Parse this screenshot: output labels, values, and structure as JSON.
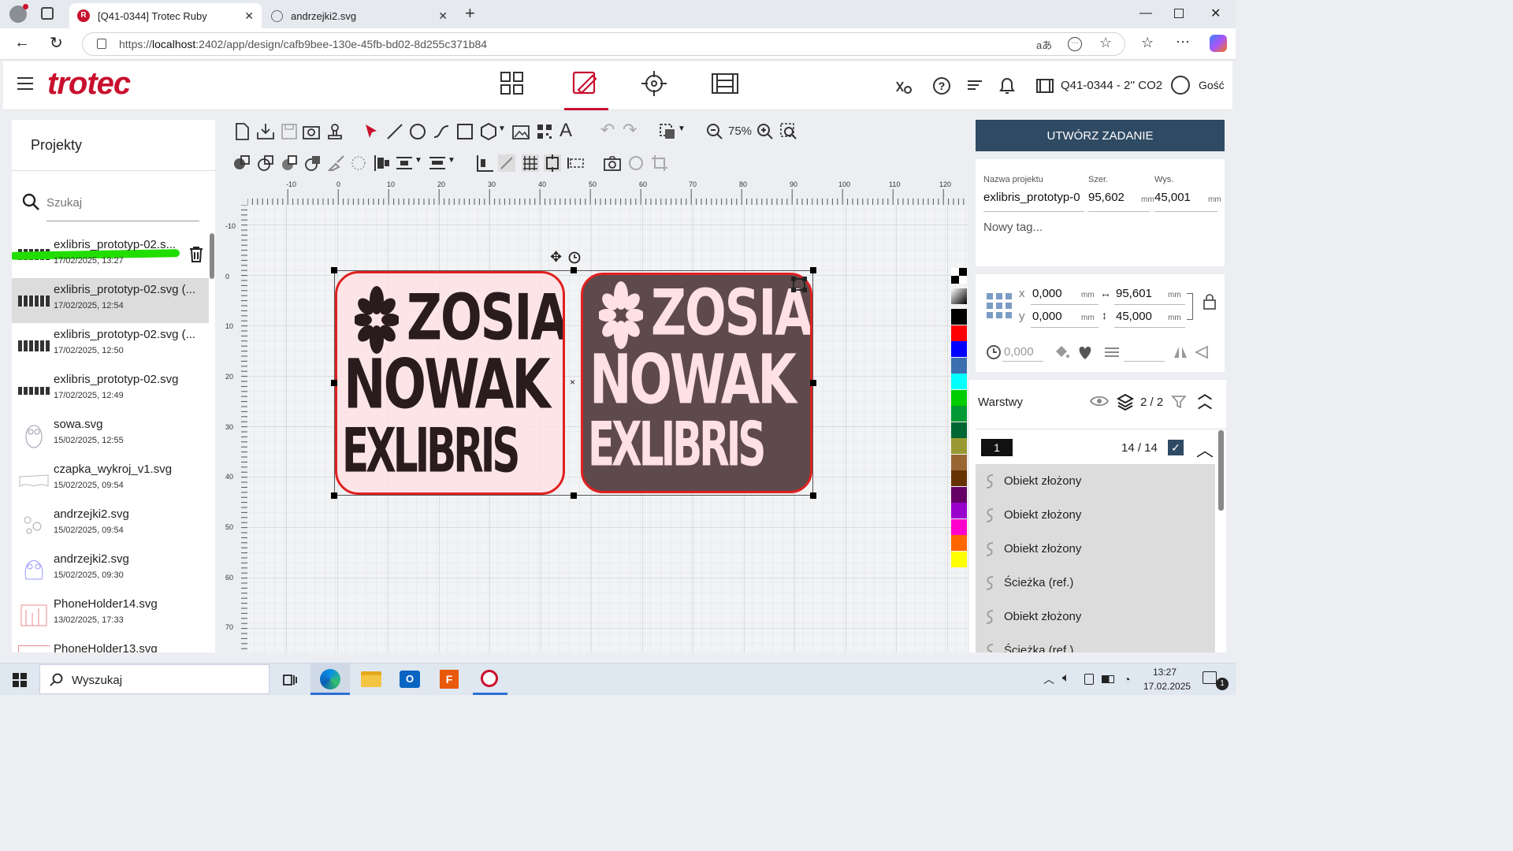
{
  "browser": {
    "tabs": [
      {
        "label": "[Q41-0344] Trotec Ruby",
        "active": true
      },
      {
        "label": "andrzejki2.svg",
        "active": false
      }
    ],
    "url_prefix": "https://",
    "url_host": "localhost",
    "url_rest": ":2402/app/design/cafb9bee-130e-45fb-bd02-8d255c371b84"
  },
  "app": {
    "logo": "trotec",
    "machine": "Q41-0344 - 2'' CO2",
    "user": "Gość"
  },
  "projects": {
    "title": "Projekty",
    "search_placeholder": "Szukaj",
    "items": [
      {
        "name": "exlibris_prototyp-02.s...",
        "date": "17/02/2025, 13:27"
      },
      {
        "name": "exlibris_prototyp-02.svg (...",
        "date": "17/02/2025, 12:54"
      },
      {
        "name": "exlibris_prototyp-02.svg (...",
        "date": "17/02/2025, 12:50"
      },
      {
        "name": "exlibris_prototyp-02.svg",
        "date": "17/02/2025, 12:49"
      },
      {
        "name": "sowa.svg",
        "date": "15/02/2025, 12:55"
      },
      {
        "name": "czapka_wykroj_v1.svg",
        "date": "15/02/2025, 09:54"
      },
      {
        "name": "andrzejki2.svg",
        "date": "15/02/2025, 09:54"
      },
      {
        "name": "andrzejki2.svg",
        "date": "15/02/2025, 09:30"
      },
      {
        "name": "PhoneHolder14.svg",
        "date": "13/02/2025, 17:33"
      },
      {
        "name": "PhoneHolder13.svg",
        "date": ""
      }
    ]
  },
  "toolbar": {
    "zoom": "75%"
  },
  "rulers": {
    "top": [
      "-10",
      "0",
      "10",
      "20",
      "30",
      "40",
      "50",
      "60",
      "70",
      "80",
      "90",
      "100",
      "110",
      "120"
    ],
    "left": [
      "-10",
      "0",
      "10",
      "20",
      "30",
      "40",
      "50",
      "60",
      "70"
    ]
  },
  "design": {
    "left_text": [
      "ZOSIA",
      "NOWAK",
      "EXLIBRIS"
    ],
    "right_text": [
      "ZOSIA",
      "NOWAK",
      "EXLIBRIS"
    ]
  },
  "palette": [
    "#000000",
    "#ff0000",
    "#0000ff",
    "#3a6fb0",
    "#00ffff",
    "#00cc00",
    "#009933",
    "#006633",
    "#999933",
    "#996633",
    "#663300",
    "#660066",
    "#9900cc",
    "#ff00cc",
    "#ff6600",
    "#ffff00"
  ],
  "job": {
    "create_button": "UTWÓRZ ZADANIE",
    "name_label": "Nazwa projektu",
    "name_value": "exlibris_prototyp-0",
    "width_label": "Szer.",
    "width_value": "95,602",
    "height_label": "Wys.",
    "height_value": "45,001",
    "unit": "mm",
    "tag_placeholder": "Nowy tag..."
  },
  "position": {
    "x_label": "x",
    "x_value": "0,000",
    "y_label": "y",
    "y_value": "0,000",
    "w_value": "95,601",
    "h_value": "45,000",
    "unit": "mm",
    "rotation": "0,000"
  },
  "layers": {
    "title": "Warstwy",
    "count": "2 / 2",
    "layer_number": "1",
    "layer_count": "14 / 14",
    "items": [
      "Obiekt złożony",
      "Obiekt złożony",
      "Obiekt złożony",
      "Ścieżka (ref.)",
      "Obiekt złożony",
      "Ścieżka (ref.)"
    ]
  },
  "taskbar": {
    "search": "Wyszukaj",
    "time": "13:27",
    "date": "17.02.2025",
    "notif": "1"
  }
}
